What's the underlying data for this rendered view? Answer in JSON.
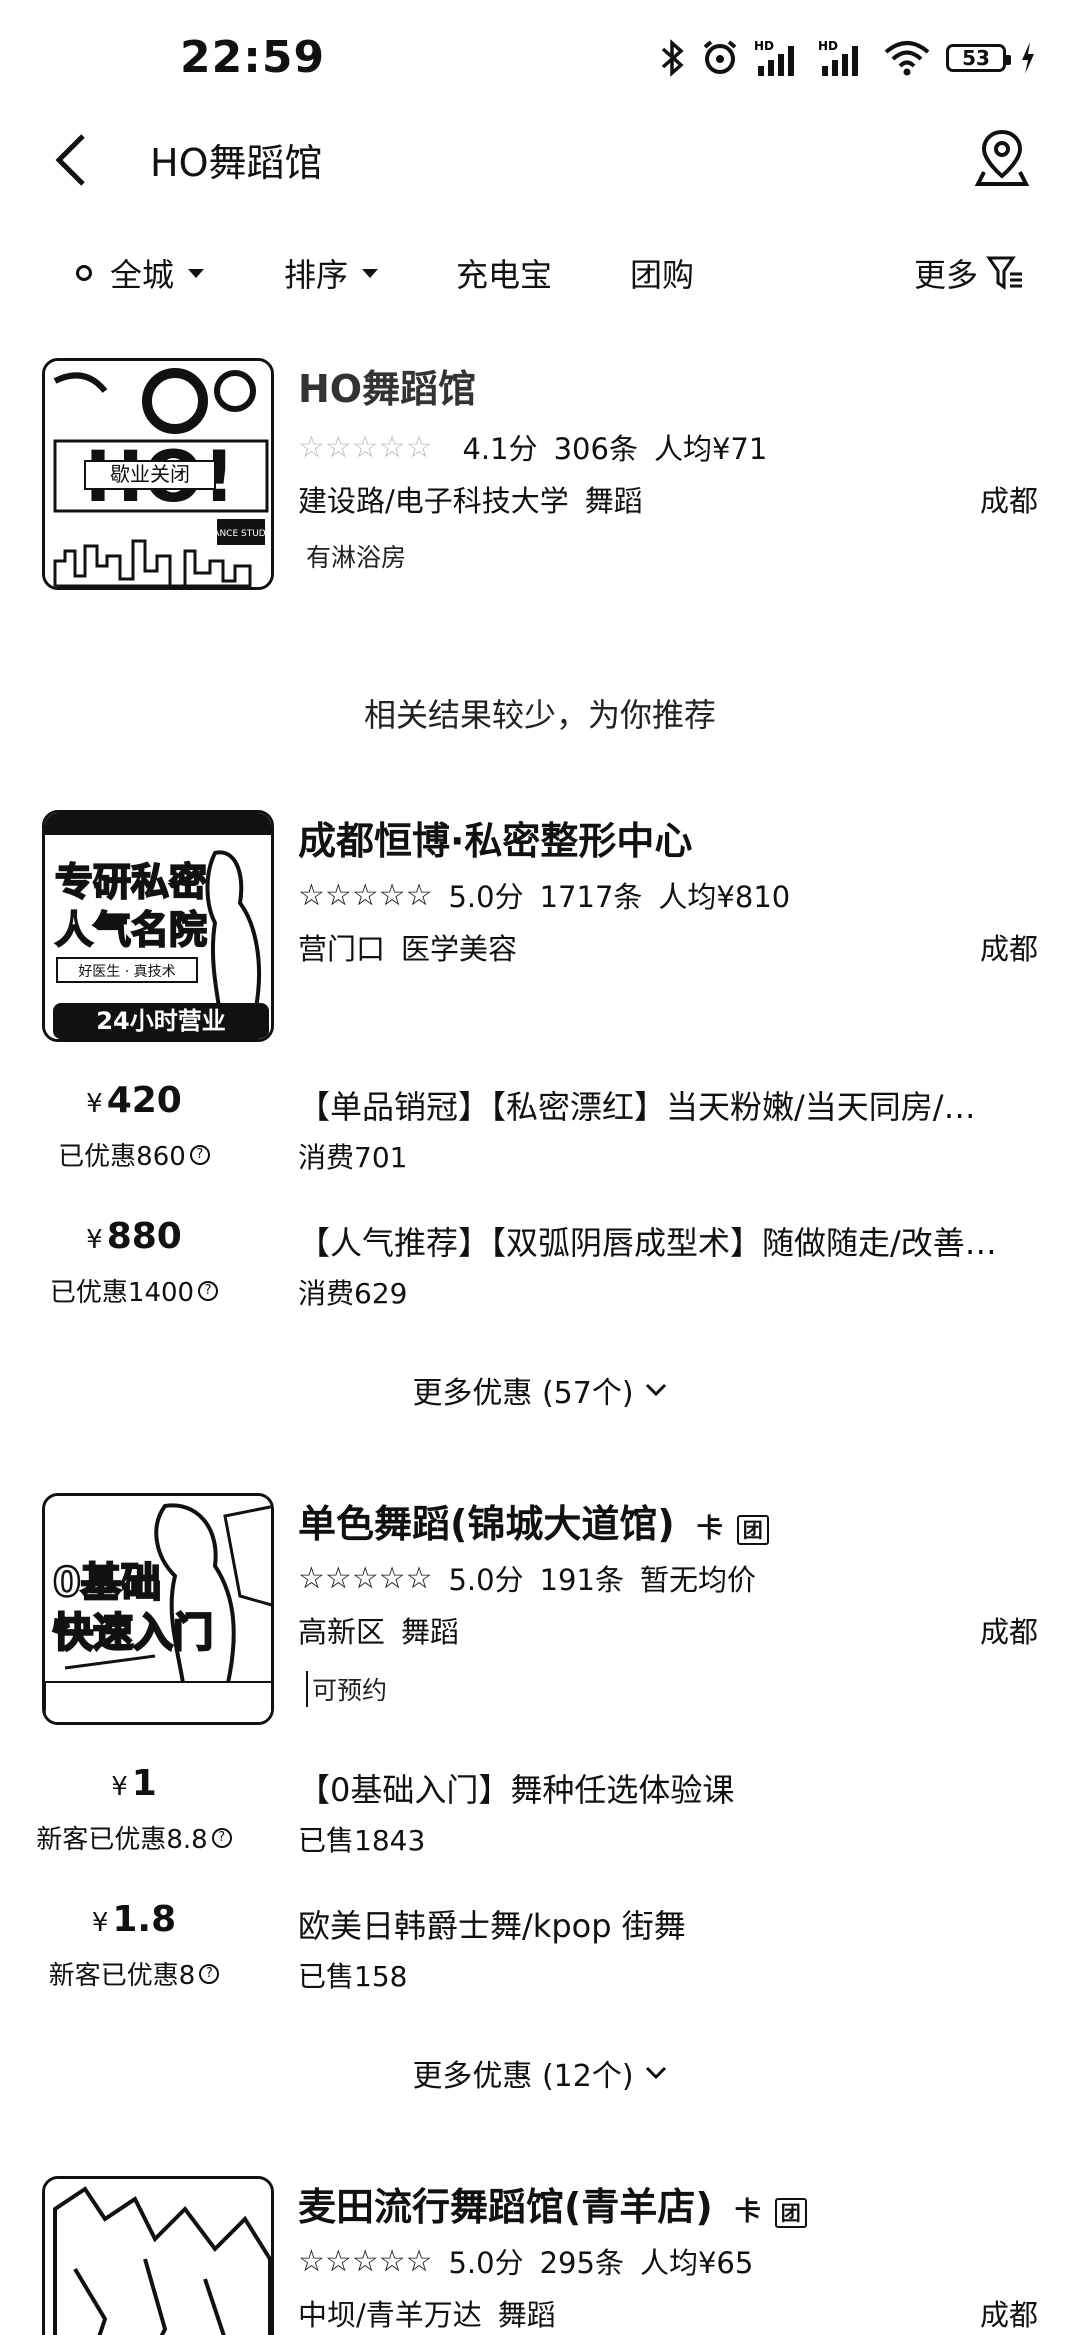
{
  "status_bar": {
    "time": "22:59",
    "battery": "53"
  },
  "header": {
    "title": "HO舞蹈馆"
  },
  "filters": {
    "city": "全城",
    "sort": "排序",
    "powerbank": "充电宝",
    "group": "团购",
    "more": "更多"
  },
  "recommend_text": "相关结果较少，为你推荐",
  "shops": [
    {
      "name": "HO舞蹈馆",
      "rating": "4.1分",
      "reviews": "306条",
      "avg_price": "人均¥71",
      "area": "建设路/电子科技大学",
      "category": "舞蹈",
      "city": "成都",
      "tag": "有淋浴房",
      "thumb_text": "歇业关闭",
      "thumb_sub": "DANCE STUDIO"
    },
    {
      "name": "成都恒博·私密整形中心",
      "rating": "5.0分",
      "reviews": "1717条",
      "avg_price": "人均¥810",
      "area": "营门口",
      "category": "医学美容",
      "city": "成都",
      "thumb_lines": [
        "专研私密",
        "人气名院",
        "好医生 · 真技术",
        "24小时营业"
      ],
      "deals": [
        {
          "yen": "¥",
          "price": "420",
          "discount": "已优惠860",
          "title": "【单品销冠】【私密漂红】当天粉嫩/当天同房/…",
          "sold": "消费701"
        },
        {
          "yen": "¥",
          "price": "880",
          "discount": "已优惠1400",
          "title": "【人气推荐】【双弧阴唇成型术】随做随走/改善…",
          "sold": "消费629"
        }
      ],
      "more_deals": "更多优惠 (57个)"
    },
    {
      "name": "单色舞蹈(锦城大道馆)",
      "card_badge": "卡",
      "group_badge": "团",
      "rating": "5.0分",
      "reviews": "191条",
      "avg_price": "暂无均价",
      "area": "高新区",
      "category": "舞蹈",
      "city": "成都",
      "tag": "可预约",
      "thumb_lines": [
        "0基础",
        "快速入门"
      ],
      "deals": [
        {
          "yen": "¥",
          "price": "1",
          "discount": "新客已优惠8.8",
          "title": "【0基础入门】舞种任选体验课",
          "sold": "已售1843"
        },
        {
          "yen": "¥",
          "price": "1.8",
          "discount": "新客已优惠8",
          "title": "欧美日韩爵士舞/kpop 街舞",
          "sold": "已售158"
        }
      ],
      "more_deals": "更多优惠 (12个)"
    },
    {
      "name": "麦田流行舞蹈馆(青羊店)",
      "card_badge": "卡",
      "group_badge": "团",
      "rating": "5.0分",
      "reviews": "295条",
      "avg_price": "人均¥65",
      "area": "中坝/青羊万达",
      "category": "舞蹈",
      "city": "成都"
    }
  ]
}
